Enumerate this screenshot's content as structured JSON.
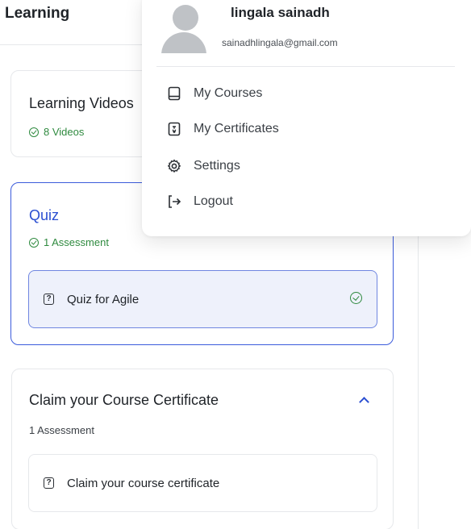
{
  "header": {
    "title": "Learning"
  },
  "sections": [
    {
      "title": "Learning Videos",
      "meta": "8 Videos"
    },
    {
      "title": "Quiz",
      "meta": "1 Assessment",
      "items": [
        {
          "label": "Quiz for Agile"
        }
      ]
    },
    {
      "title": "Claim your Course Certificate",
      "meta": "1 Assessment",
      "items": [
        {
          "label": "Claim your course certificate"
        }
      ]
    }
  ],
  "profile_menu": {
    "user_name": "lingala sainadh",
    "email": "sainadhlingala@gmail.com",
    "items": [
      {
        "label": "My Courses",
        "icon": "book-icon"
      },
      {
        "label": "My Certificates",
        "icon": "certificate-icon"
      },
      {
        "label": "Settings",
        "icon": "gear-icon"
      },
      {
        "label": "Logout",
        "icon": "logout-icon"
      }
    ]
  },
  "colors": {
    "accent": "#2b4fd1",
    "success": "#2f8a3f",
    "border": "#e6e8eb"
  }
}
